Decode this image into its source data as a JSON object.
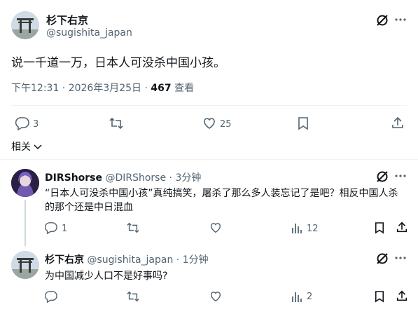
{
  "main_post": {
    "display_name": "杉下右京",
    "handle": "@sugishita_japan",
    "text": "说一千道一万，日本人可没杀中国小孩。",
    "time": "下午12:31 · 2026年3月25日 · ",
    "views_count": "467",
    "views_label": " 查看",
    "replies": "3",
    "likes": "25",
    "related_label": "相关"
  },
  "replies": [
    {
      "display_name": "DIRShorse",
      "handle": "@DIRShorse",
      "time": " · 3分钟",
      "text": "“日本人可没杀中国小孩”真纯搞笑，屠杀了那么多人装忘记了是吧？相反中国人杀的那个还是中日混血",
      "replies": "1",
      "views": "12"
    },
    {
      "display_name": "杉下右京",
      "handle": "@sugishita_japan",
      "time": " · 1分钟",
      "text": "为中国减少人口不是好事吗?",
      "views": "2"
    }
  ]
}
